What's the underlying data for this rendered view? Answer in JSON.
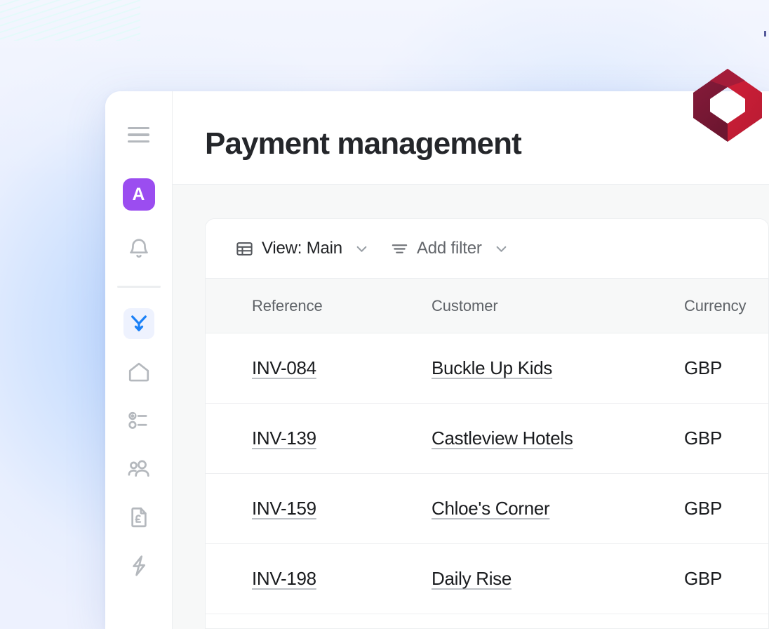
{
  "brand": {
    "logo_name": "diamond-hexagon-logo",
    "color_dark": "#8c1d3c",
    "color_bright": "#d12139"
  },
  "theme": {
    "background": "#edf1fe",
    "glow": "#a8caff",
    "avatar_bg": "#9b4df0",
    "accent_blue": "#1b81f7",
    "active_nav_bg": "#eef2fe",
    "surface": "#ffffff",
    "content_bg": "#f7f8f8",
    "border": "#eceef0",
    "text_primary": "#1a1c1f",
    "text_muted": "#5f6368"
  },
  "sidebar": {
    "menu_button": {
      "name": "hamburger-menu",
      "label": "Menu"
    },
    "avatar": {
      "initial": "A",
      "label": "Account"
    },
    "items": [
      {
        "icon": "bell-icon",
        "label": "Notifications",
        "active": false
      },
      {
        "icon": "payments-split-arrow-icon",
        "label": "Payments",
        "active": true
      },
      {
        "icon": "home-icon",
        "label": "Home",
        "active": false
      },
      {
        "icon": "tasks-checklist-icon",
        "label": "Tasks",
        "active": false
      },
      {
        "icon": "people-icon",
        "label": "Customers",
        "active": false
      },
      {
        "icon": "invoice-pound-icon",
        "label": "Invoices",
        "active": false
      },
      {
        "icon": "lightning-bolt-icon",
        "label": "Automations",
        "active": false
      }
    ]
  },
  "header": {
    "title": "Payment management"
  },
  "toolbar": {
    "view": {
      "icon": "table-grid-icon",
      "label": "View: Main",
      "chevron": "chevron-down-icon"
    },
    "filter": {
      "icon": "filter-lines-icon",
      "label": "Add filter",
      "chevron": "chevron-down-icon"
    }
  },
  "table": {
    "columns": [
      "Reference",
      "Customer",
      "Currency"
    ],
    "rows": [
      {
        "reference": "INV-084",
        "customer": "Buckle Up Kids",
        "currency": "GBP"
      },
      {
        "reference": "INV-139",
        "customer": "Castleview Hotels",
        "currency": "GBP"
      },
      {
        "reference": "INV-159",
        "customer": "Chloe's Corner",
        "currency": "GBP"
      },
      {
        "reference": "INV-198",
        "customer": "Daily Rise",
        "currency": "GBP"
      }
    ]
  }
}
